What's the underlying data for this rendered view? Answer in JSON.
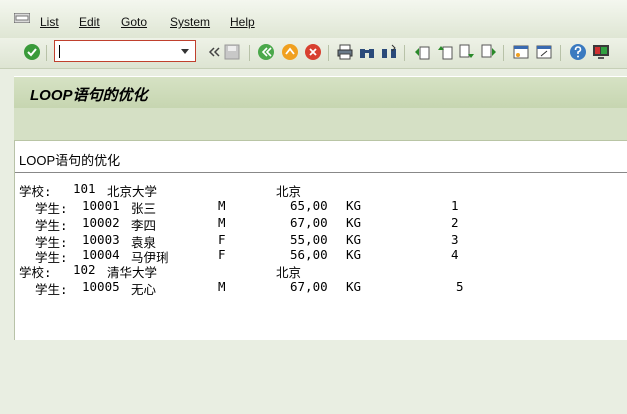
{
  "menu": {
    "items": [
      "List",
      "Edit",
      "Goto",
      "System",
      "Help"
    ]
  },
  "toolbar": {
    "command_value": ""
  },
  "title": "LOOP语句的优化",
  "list": {
    "header": "LOOP语句的优化",
    "rows": [
      {
        "type": "school",
        "label": "学校:",
        "code": "101",
        "name": "北京大学",
        "city": "北京"
      },
      {
        "type": "student",
        "label": "学生:",
        "id": "10001",
        "name": "张三",
        "gender": "M",
        "weight": "65,00",
        "unit": "KG",
        "no": "1"
      },
      {
        "type": "student",
        "label": "学生:",
        "id": "10002",
        "name": "李四",
        "gender": "M",
        "weight": "67,00",
        "unit": "KG",
        "no": "2"
      },
      {
        "type": "student",
        "label": "学生:",
        "id": "10003",
        "name": "袁泉",
        "gender": "F",
        "weight": "55,00",
        "unit": "KG",
        "no": "3"
      },
      {
        "type": "student",
        "label": "学生:",
        "id": "10004",
        "name": "马伊琍",
        "gender": "F",
        "weight": "56,00",
        "unit": "KG",
        "no": "4"
      },
      {
        "type": "school",
        "label": "学校:",
        "code": "102",
        "name": "清华大学",
        "city": "北京"
      },
      {
        "type": "student",
        "label": "学生:",
        "id": "10005",
        "name": "无心",
        "gender": "M",
        "weight": "67,00",
        "unit": "KG",
        "no": "5"
      }
    ]
  }
}
